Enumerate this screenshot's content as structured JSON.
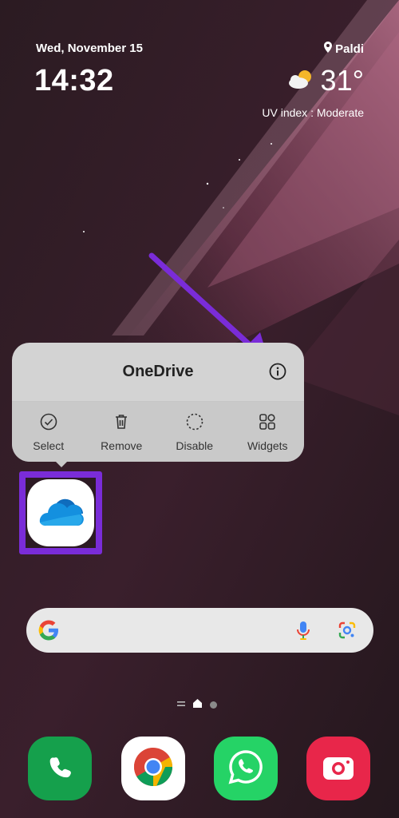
{
  "status": {
    "date": "Wed, November 15",
    "time": "14:32",
    "location": "Paldi",
    "temperature": "31°",
    "uv": "UV index : Moderate"
  },
  "popup": {
    "title": "OneDrive",
    "actions": [
      {
        "label": "Select",
        "icon": "check-circle-icon"
      },
      {
        "label": "Remove",
        "icon": "trash-icon"
      },
      {
        "label": "Disable",
        "icon": "dashed-circle-icon"
      },
      {
        "label": "Widgets",
        "icon": "widgets-icon"
      }
    ]
  },
  "app": {
    "name": "OneDrive",
    "icon": "onedrive-cloud-icon"
  },
  "search": {
    "placeholder": ""
  },
  "dock": [
    "phone-icon",
    "chrome-icon",
    "whatsapp-icon",
    "camera-icon"
  ],
  "colors": {
    "highlight": "#7a2cd8",
    "arrow": "#7a2cd8",
    "onedrive_blue": "#0f6cbd",
    "phone_green": "#1a9e4a",
    "whatsapp_green": "#25d366",
    "camera_red": "#e8264a"
  }
}
